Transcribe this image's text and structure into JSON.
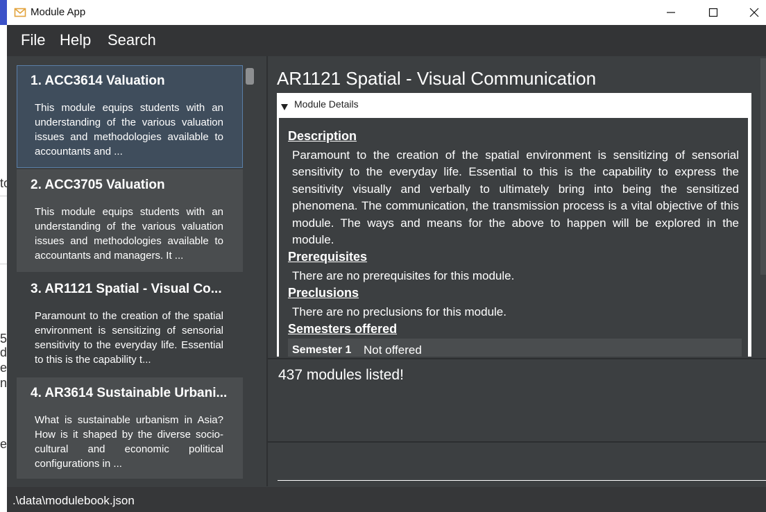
{
  "window": {
    "title": "Module App"
  },
  "menu": {
    "file": "File",
    "help": "Help",
    "search": "Search"
  },
  "modules": [
    {
      "title": "1.  ACC3614 Valuation",
      "desc": "This module equips students with an understanding of the various valuation issues and methodologies available to accountants and ..."
    },
    {
      "title": "2.  ACC3705 Valuation",
      "desc": "This module equips students with an understanding of the various valuation issues and methodologies available to accountants and managers. It ..."
    },
    {
      "title": "3.  AR1121 Spatial -  Visual Co...",
      "desc": "Paramount to the creation of the spatial environment is sensitizing of sensorial sensitivity to the everyday life. Essential to this is the capability t..."
    },
    {
      "title": "4.  AR3614 Sustainable Urbani...",
      "desc": "What is sustainable urbanism in Asia? How is it shaped by the diverse socio-cultural and economic political configurations in ..."
    }
  ],
  "detail": {
    "title": "AR1121 Spatial -  Visual Communication",
    "section_header": "Module Details",
    "description_label": "Description",
    "description": "Paramount to the creation of the spatial environment is sensitizing of sensorial sensitivity to the everyday life. Essential to this is the capability to express the sensitivity visually and verbally to ultimately bring into being the sensitized phenomena. The communication, the transmission process is a vital objective of this module. The ways and means for the above to happen will be explored in the module.",
    "prerequisites_label": "Prerequisites",
    "prerequisites": "There are no prerequisites for this module.",
    "preclusions_label": "Preclusions",
    "preclusions": "There are no preclusions for this module.",
    "semesters_label": "Semesters offered",
    "semesters": [
      {
        "name": "Semester 1",
        "status": "Not offered"
      }
    ]
  },
  "result": {
    "text": "437 modules listed!"
  },
  "status": {
    "path": ".\\data\\modulebook.json"
  },
  "background_fragments": [
    "to",
    "5",
    "d",
    "e",
    "nt",
    "es"
  ],
  "colors": {
    "selected_card": "#3f4d5c",
    "panel": "#3c3f41",
    "accent_border": "#5a7fa8"
  }
}
